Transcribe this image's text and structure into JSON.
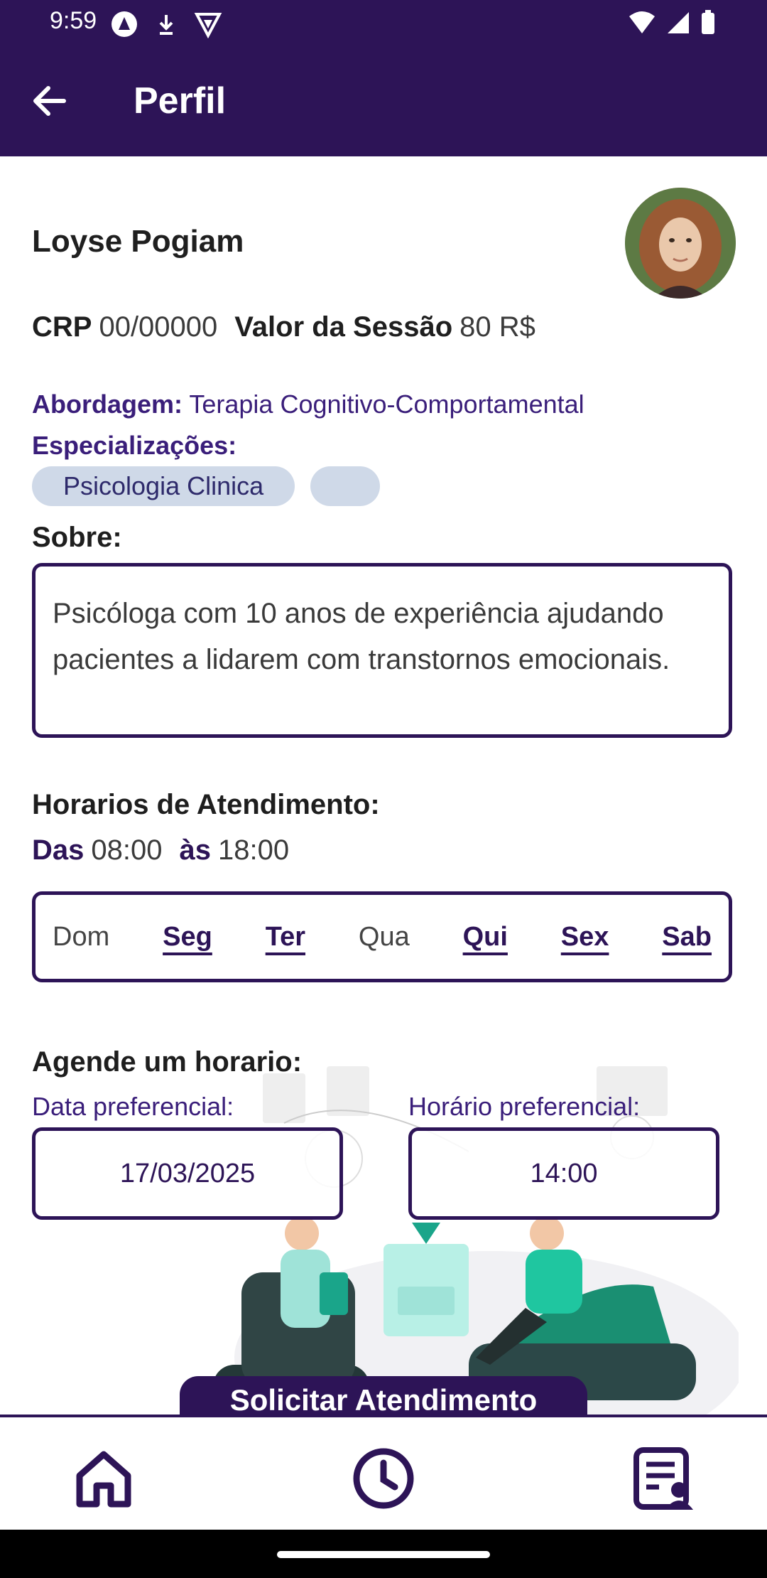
{
  "status_bar": {
    "time": "9:59"
  },
  "app_bar": {
    "title": "Perfil"
  },
  "profile": {
    "name": "Loyse Pogiam",
    "crp_label": "CRP",
    "crp_value": "00/00000",
    "price_label": "Valor da Sessão",
    "price_value": "80 R$",
    "approach_label": "Abordagem:",
    "approach_value": "Terapia Cognitivo-Comportamental",
    "specializations_label": "Especializações:",
    "specializations": [
      "Psicologia Clinica",
      ""
    ],
    "about_label": "Sobre:",
    "about_text": "Psicóloga com 10 anos de experiência ajudando pacientes a lidarem com transtornos emocionais."
  },
  "schedule": {
    "label": "Horarios de Atendimento:",
    "from_label": "Das",
    "from_value": "08:00",
    "to_label": "às",
    "to_value": "18:00",
    "days": [
      {
        "label": "Dom",
        "active": false
      },
      {
        "label": "Seg",
        "active": true
      },
      {
        "label": "Ter",
        "active": true
      },
      {
        "label": "Qua",
        "active": false
      },
      {
        "label": "Qui",
        "active": true
      },
      {
        "label": "Sex",
        "active": true
      },
      {
        "label": "Sab",
        "active": true
      }
    ]
  },
  "booking": {
    "label": "Agende um horario:",
    "date_label": "Data preferencial:",
    "date_value": "17/03/2025",
    "time_label": "Horário preferencial:",
    "time_value": "14:00",
    "submit_label": "Solicitar Atendimento"
  },
  "bottom_nav": {
    "items": [
      {
        "icon": "home-icon"
      },
      {
        "icon": "clock-icon"
      },
      {
        "icon": "profile-list-icon"
      }
    ]
  },
  "colors": {
    "primary": "#2d1457",
    "chip_bg": "#cfd9e8",
    "accent_text": "#3a1e7a"
  }
}
